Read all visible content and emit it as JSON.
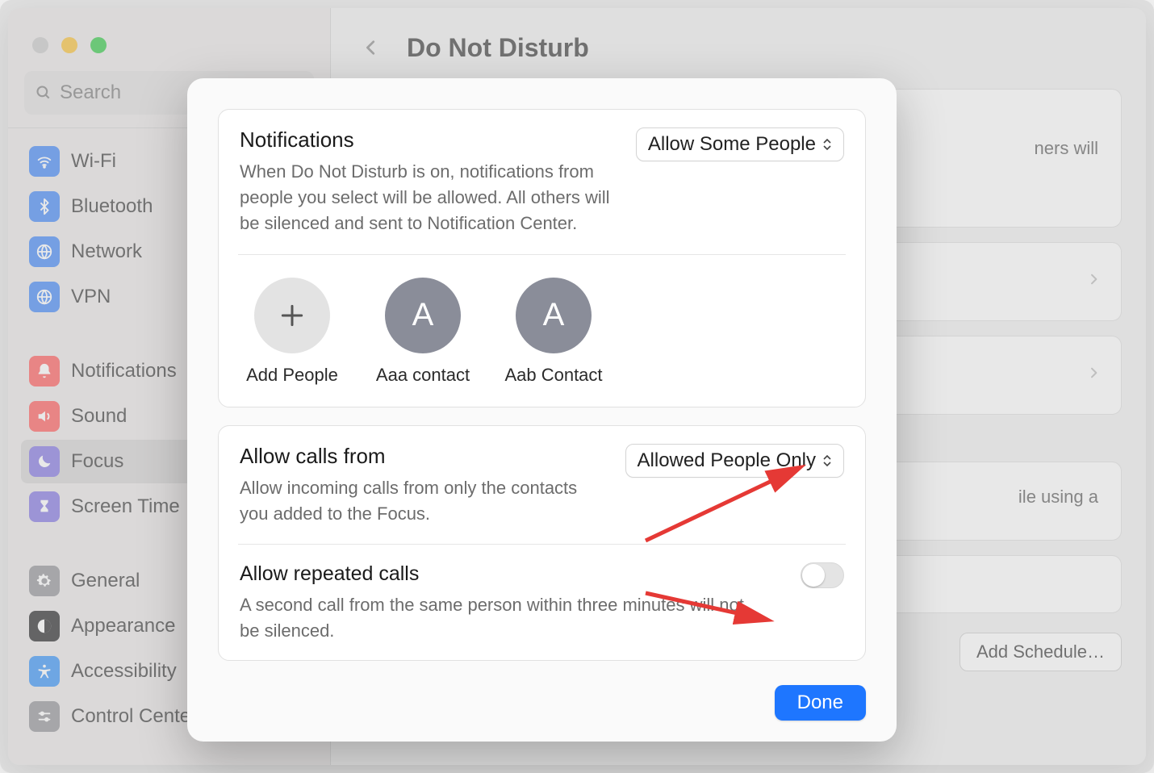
{
  "window": {
    "search_placeholder": "Search",
    "page_title": "Do Not Disturb"
  },
  "sidebar": {
    "groups": [
      [
        {
          "label": "Wi-Fi",
          "icon": "wifi",
          "bg": "#3a82f6"
        },
        {
          "label": "Bluetooth",
          "icon": "bluetooth",
          "bg": "#3a82f6"
        },
        {
          "label": "Network",
          "icon": "globe",
          "bg": "#3a82f6"
        },
        {
          "label": "VPN",
          "icon": "vpn",
          "bg": "#3a82f6"
        }
      ],
      [
        {
          "label": "Notifications",
          "icon": "bell",
          "bg": "#f55"
        },
        {
          "label": "Sound",
          "icon": "speaker",
          "bg": "#f55"
        },
        {
          "label": "Focus",
          "icon": "moon",
          "bg": "#7d6fe0",
          "selected": true
        },
        {
          "label": "Screen Time",
          "icon": "hourglass",
          "bg": "#7d6fe0"
        }
      ],
      [
        {
          "label": "General",
          "icon": "gear",
          "bg": "#8e8e93"
        },
        {
          "label": "Appearance",
          "icon": "appearance",
          "bg": "#1c1c1e"
        },
        {
          "label": "Accessibility",
          "icon": "accessibility",
          "bg": "#2e8df6"
        },
        {
          "label": "Control Center",
          "icon": "sliders",
          "bg": "#8e8e93"
        }
      ]
    ]
  },
  "bg_content": {
    "hint1_tail": "ners will",
    "hint2_tail": "ile using a",
    "add_schedule": "Add Schedule…"
  },
  "modal": {
    "notifications": {
      "title": "Notifications",
      "desc": "When Do Not Disturb is on, notifications from people you select will be allowed. All others will be silenced and sent to Notification Center.",
      "select_value": "Allow Some People",
      "add_people_label": "Add People",
      "people": [
        {
          "initial": "A",
          "name": "Aaa contact"
        },
        {
          "initial": "A",
          "name": "Aab Contact"
        }
      ]
    },
    "calls": {
      "title": "Allow calls from",
      "desc": "Allow incoming calls from only the contacts you added to the Focus.",
      "select_value": "Allowed People Only",
      "repeated_title": "Allow repeated calls",
      "repeated_desc": "A second call from the same person within three minutes will not be silenced."
    },
    "done_label": "Done"
  }
}
